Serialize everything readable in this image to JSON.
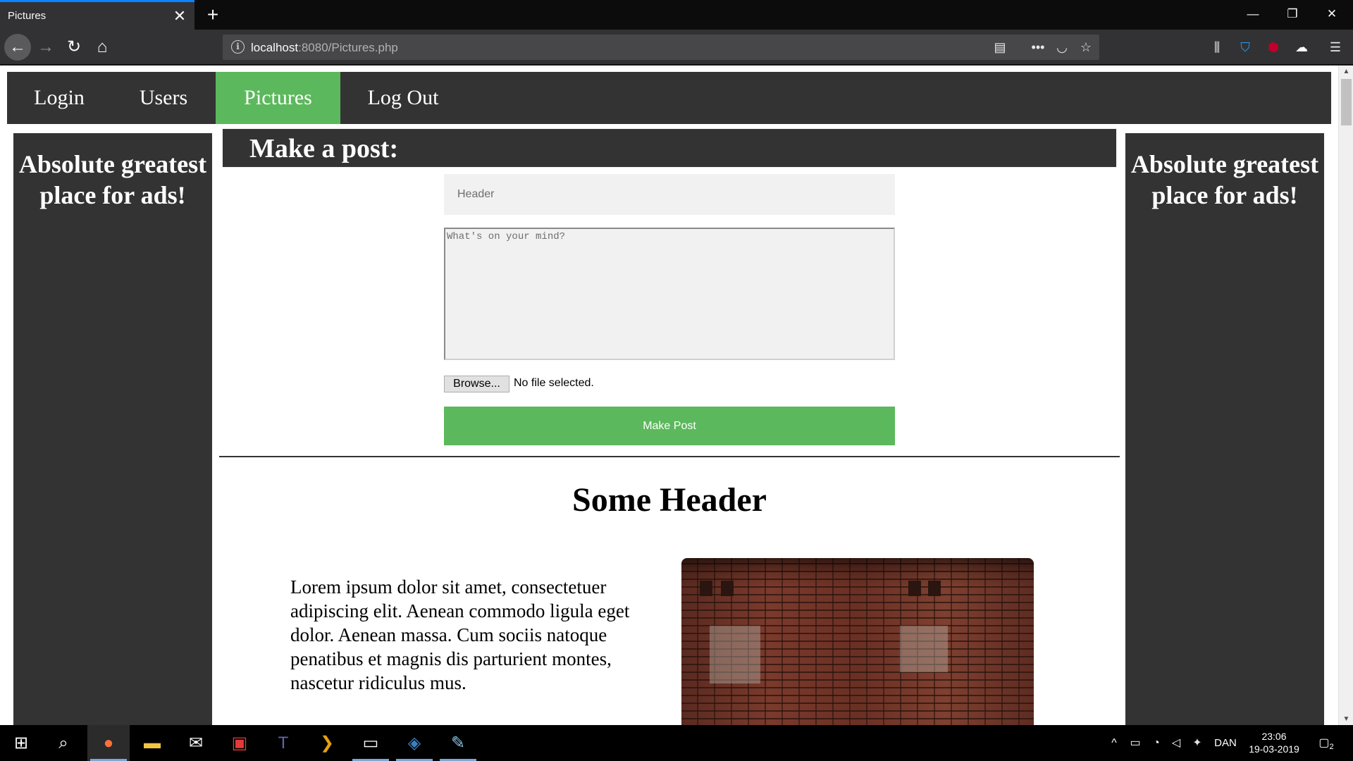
{
  "browser": {
    "tab_title": "Pictures",
    "tab_close_icon": "close-icon",
    "new_tab_icon": "plus-icon",
    "url_host": "localhost",
    "url_rest": ":8080/Pictures.php",
    "window_controls": [
      "minimize-icon",
      "restore-icon",
      "close-icon"
    ],
    "toolbar_icons": [
      "library-icon",
      "shield-icon",
      "ublock-icon",
      "cloud-icon",
      "hamburger-menu-icon"
    ],
    "url_icons": [
      "reader-view-icon",
      "more-actions-icon",
      "pocket-icon",
      "bookmark-star-icon"
    ]
  },
  "site_nav": {
    "items": [
      {
        "label": "Login",
        "active": false
      },
      {
        "label": "Users",
        "active": false
      },
      {
        "label": "Pictures",
        "active": true
      },
      {
        "label": "Log Out",
        "active": false
      }
    ]
  },
  "ads": {
    "left": "Absolute greatest place for ads!",
    "right": "Absolute greatest place for ads!"
  },
  "post_form": {
    "title": "Make a post:",
    "header_placeholder": "Header",
    "body_placeholder": "What's on your mind?",
    "browse_label": "Browse...",
    "file_status": "No file selected.",
    "submit_label": "Make Post"
  },
  "post": {
    "header": "Some Header",
    "body": "Lorem ipsum dolor sit amet, consectetuer adipiscing elit. Aenean commodo ligula eget dolor. Aenean massa. Cum sociis natoque penatibus et magnis dis parturient montes, nascetur ridiculus mus.",
    "image": "brick-wall-photo"
  },
  "taskbar": {
    "apps": [
      "windows-start-icon",
      "search-icon",
      "firefox-icon",
      "file-explorer-icon",
      "mail-icon",
      "film-app-icon",
      "teams-icon",
      "plex-icon",
      "terminal-icon",
      "visual-studio-icon",
      "paint-icon"
    ],
    "language": "DAN",
    "time": "23:06",
    "date": "19-03-2019",
    "notification_count": "2"
  },
  "colors": {
    "accent_green": "#5cb85c",
    "panel_dark": "#333333",
    "firefox_blue": "#0a84ff"
  }
}
